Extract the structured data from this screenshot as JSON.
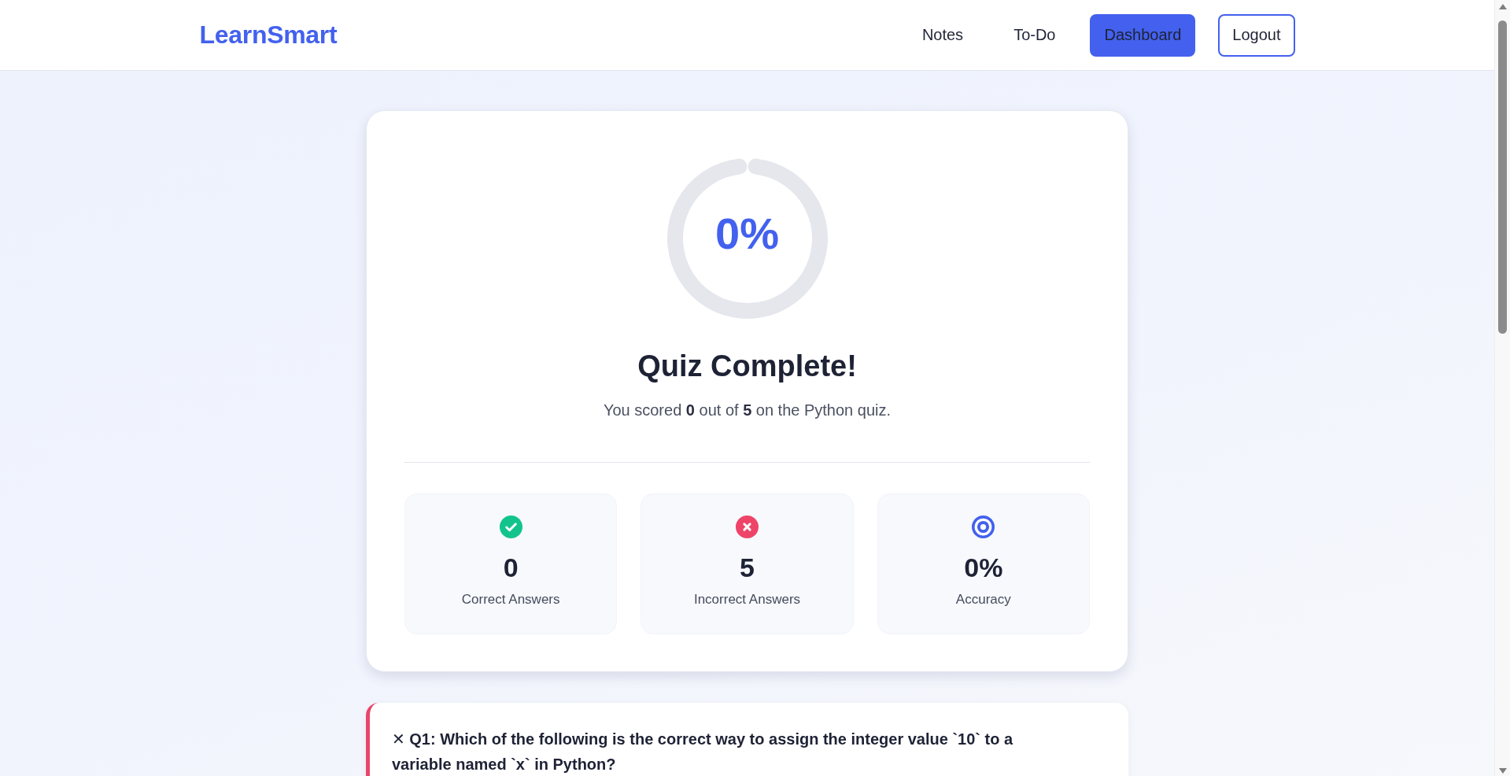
{
  "header": {
    "logo": "LearnSmart",
    "nav": [
      {
        "label": "Notes",
        "kind": "link"
      },
      {
        "label": "To-Do",
        "kind": "link"
      },
      {
        "label": "Dashboard",
        "kind": "primary"
      },
      {
        "label": "Logout",
        "kind": "outline"
      }
    ]
  },
  "result": {
    "score": {
      "percent": "0%"
    },
    "title": "Quiz Complete!",
    "summary": "You scored **0** out of **5** on the Python quiz.",
    "stats": [
      {
        "kind": "correct",
        "value": "0",
        "label": "Correct Answers"
      },
      {
        "kind": "incorrect",
        "value": "5",
        "label": "Incorrect Answers"
      },
      {
        "kind": "accuracy",
        "value": "0%",
        "label": "Accuracy"
      }
    ]
  },
  "questions": [
    {
      "text": "✕ Q1: Which of the following is the correct way to assign the integer value `10` to a variable named `x` in Python?",
      "correct": false
    }
  ]
}
